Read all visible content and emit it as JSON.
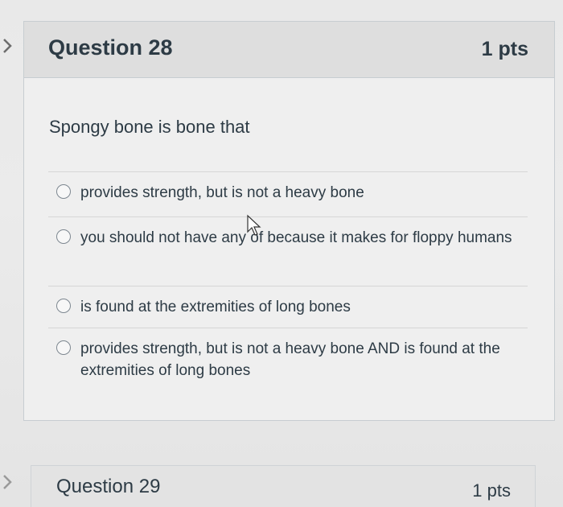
{
  "question": {
    "title": "Question 28",
    "points": "1 pts",
    "text": "Spongy bone is bone that",
    "answers": [
      {
        "label": "provides strength, but is not a heavy bone"
      },
      {
        "label": "you should not have any of because it makes for floppy humans"
      },
      {
        "label": "is found at the extremities of long bones"
      },
      {
        "label": "provides strength, but is not a heavy bone AND is found at the extremities of long bones"
      }
    ]
  },
  "next_question": {
    "title": "Question 29",
    "points": "1 pts"
  },
  "icons": {
    "left_toggle": "chevron-right-icon",
    "cursor": "mouse-pointer-icon"
  },
  "colors": {
    "text": "#2d3b45",
    "header_bg": "#dedede",
    "border": "#c7cdd1"
  }
}
